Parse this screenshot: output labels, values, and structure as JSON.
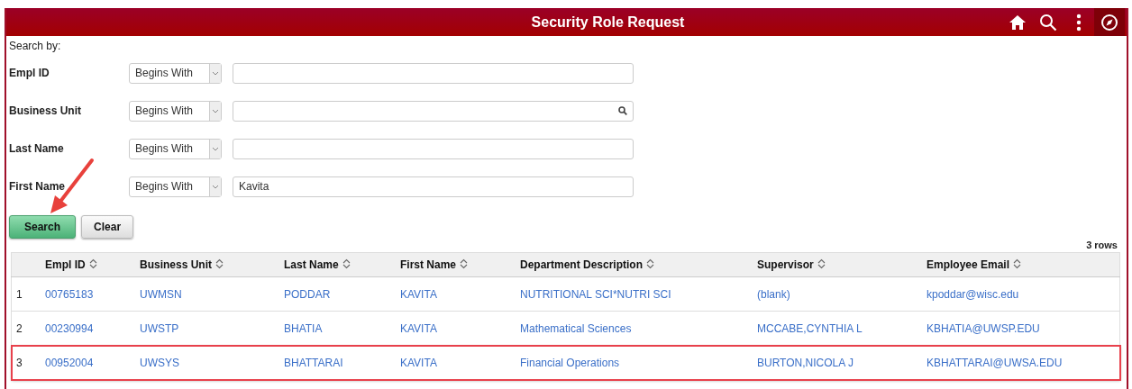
{
  "window": {
    "title": "Security Role Request"
  },
  "toolbar": [
    {
      "kind": "home"
    },
    {
      "kind": "search"
    },
    {
      "kind": "menu"
    },
    {
      "kind": "navigator"
    }
  ],
  "search_by_label": "Search by:",
  "criteria": [
    {
      "label": "Empl ID",
      "operator": "Begins With",
      "lookup": false
    },
    {
      "label": "Business Unit",
      "operator": "Begins With",
      "lookup": true
    },
    {
      "label": "Last Name",
      "operator": "Begins With",
      "lookup": false
    },
    {
      "label": "First Name",
      "operator": "Begins With",
      "value": "Kavita",
      "lookup": false
    }
  ],
  "buttons": [
    {
      "label": "Search",
      "kind": "primary",
      "pointed_by_arrow": true
    },
    {
      "label": "Clear",
      "kind": "secondary",
      "pointed_by_arrow": false
    }
  ],
  "row_count": "3 rows",
  "table": {
    "columns": [
      "Empl ID",
      "Business Unit",
      "Last Name",
      "First Name",
      "Department Description",
      "Supervisor",
      "Employee Email"
    ],
    "rows": [
      {
        "number": "1",
        "cells": [
          "00765183",
          "UWMSN",
          "PODDAR",
          "KAVITA",
          "NUTRITIONAL SCI*NUTRI SCI",
          "(blank)",
          "kpoddar@wisc.edu"
        ],
        "highlighted": false
      },
      {
        "number": "2",
        "cells": [
          "00230994",
          "UWSTP",
          "BHATIA",
          "KAVITA",
          "Mathematical Sciences",
          "MCCABE,CYNTHIA L",
          "KBHATIA@UWSP.EDU"
        ],
        "highlighted": false
      },
      {
        "number": "3",
        "cells": [
          "00952004",
          "UWSYS",
          "BHATTARAI",
          "KAVITA",
          "Financial Operations",
          "BURTON,NICOLA J",
          "KBHATTARAI@UWSA.EDU"
        ],
        "highlighted": true
      }
    ]
  }
}
